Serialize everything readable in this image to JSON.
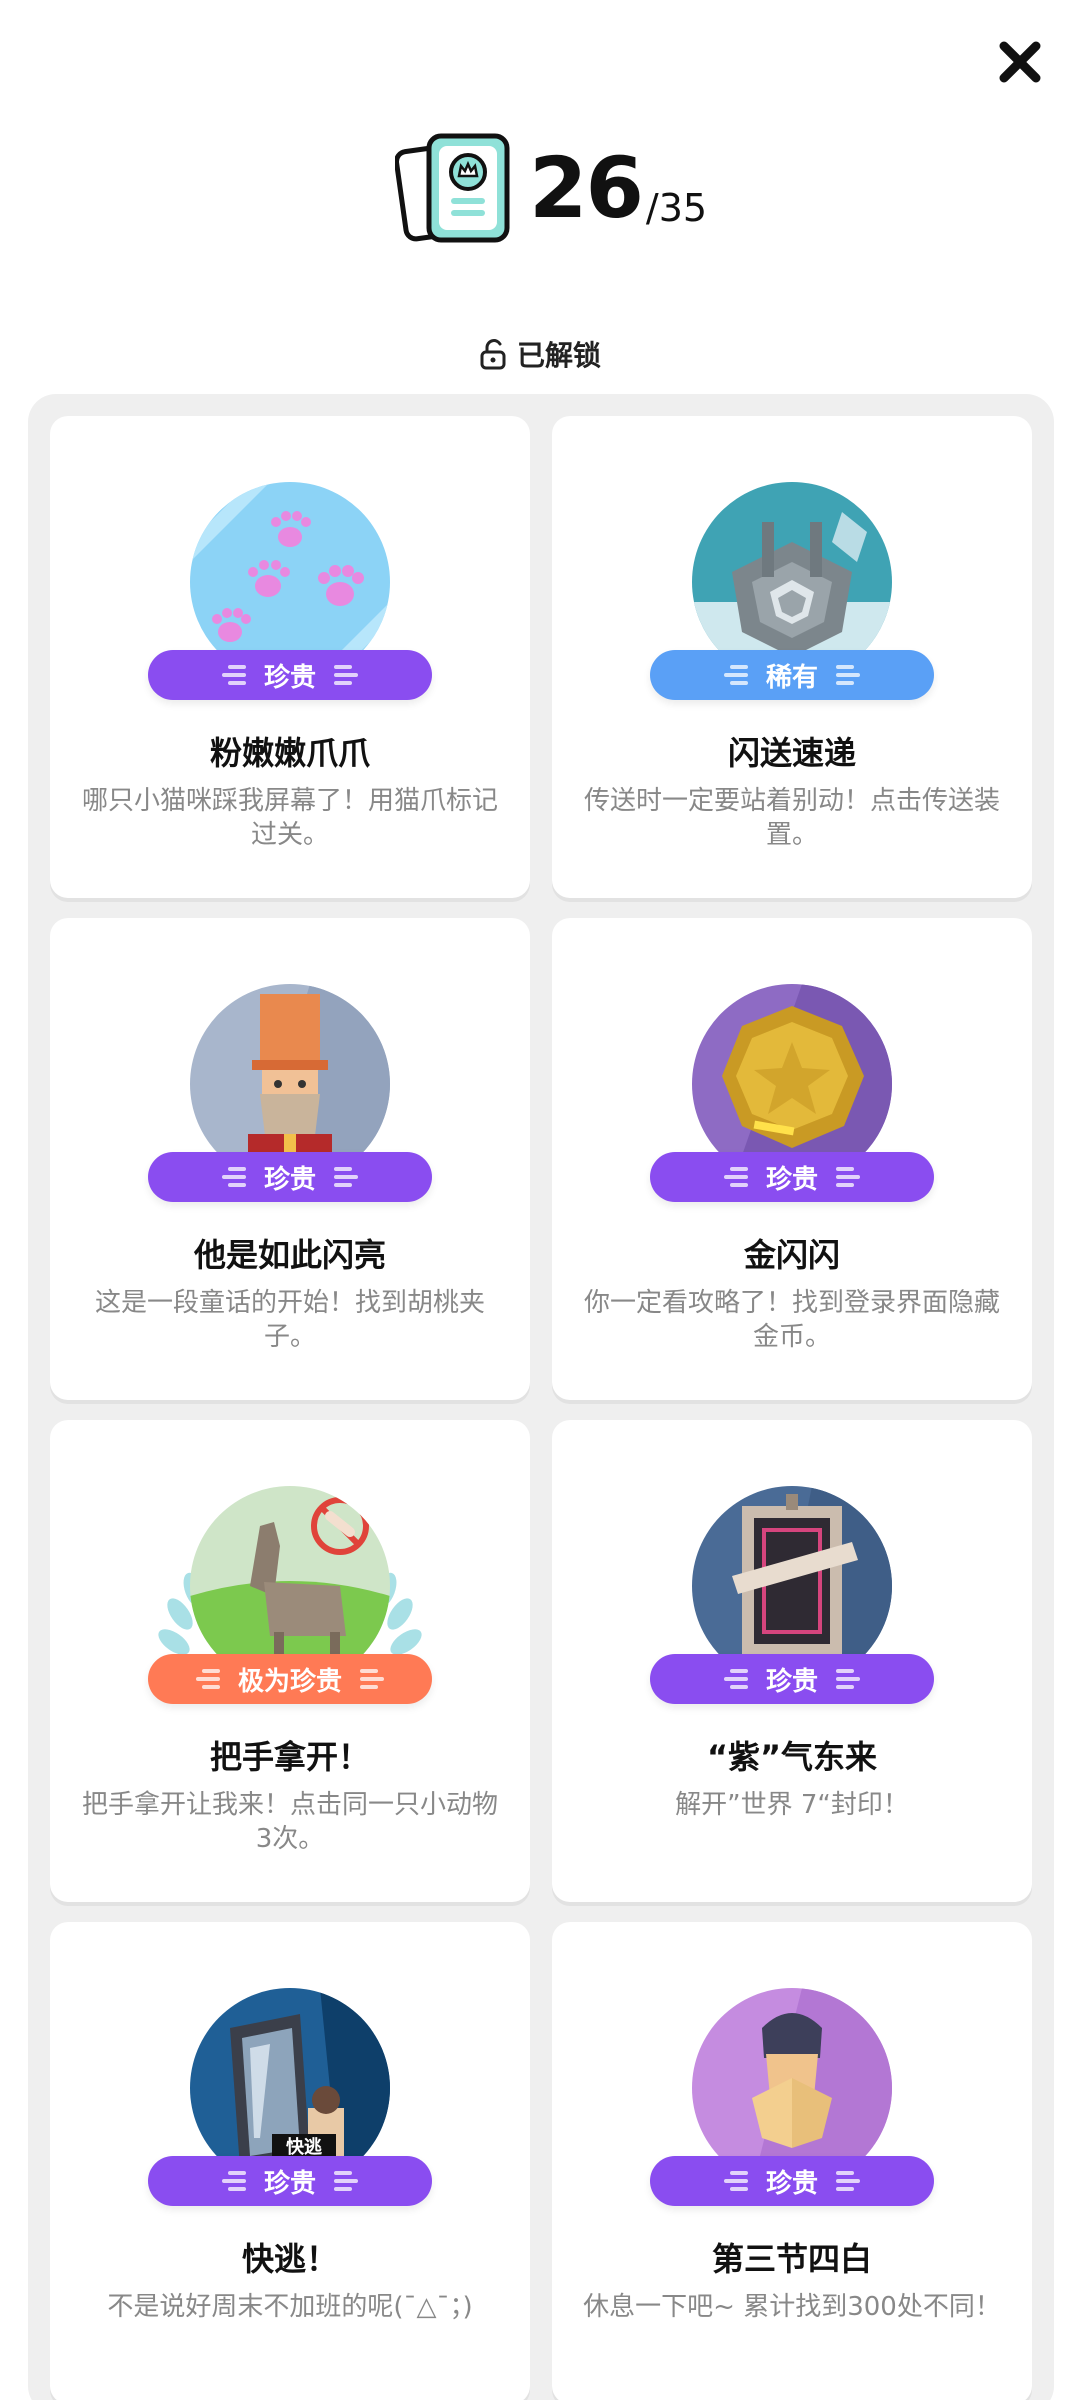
{
  "header": {
    "unlocked_count": "26",
    "total_count": "/35",
    "unlocked_label": "已解锁",
    "icons": [
      "close-icon",
      "achievement-book-icon",
      "lock-open-icon"
    ]
  },
  "colors": {
    "rare_purple": "#8a4df0",
    "uncommon_blue": "#5aa0f6",
    "legendary_orange": "#ff7a55"
  },
  "achievements": [
    {
      "title": "粉嫩嫩爪爪",
      "rarity": "珍贵",
      "desc": "哪只小猫咪踩我屏幕了！用猫爪标记过关。"
    },
    {
      "title": "闪送速递",
      "rarity": "稀有",
      "desc": "传送时一定要站着别动！点击传送装置。"
    },
    {
      "title": "他是如此闪亮",
      "rarity": "珍贵",
      "desc": "这是一段童话的开始！找到胡桃夹子。"
    },
    {
      "title": "金闪闪",
      "rarity": "珍贵",
      "desc": "你一定看攻略了！找到登录界面隐藏金币。"
    },
    {
      "title": "把手拿开！",
      "rarity": "极为珍贵",
      "desc": "把手拿开让我来！点击同一只小动物3次。"
    },
    {
      "title": "“紫”气东来",
      "rarity": "珍贵",
      "desc": "解开”世界 7“封印！"
    },
    {
      "title": "快逃！",
      "rarity": "珍贵",
      "desc": "不是说好周末不加班的呢(ˉ△ˉ；)",
      "image_text": "快逃"
    },
    {
      "title": "第三节四白",
      "rarity": "珍贵",
      "desc": "休息一下吧~ 累计找到300处不同！"
    }
  ]
}
